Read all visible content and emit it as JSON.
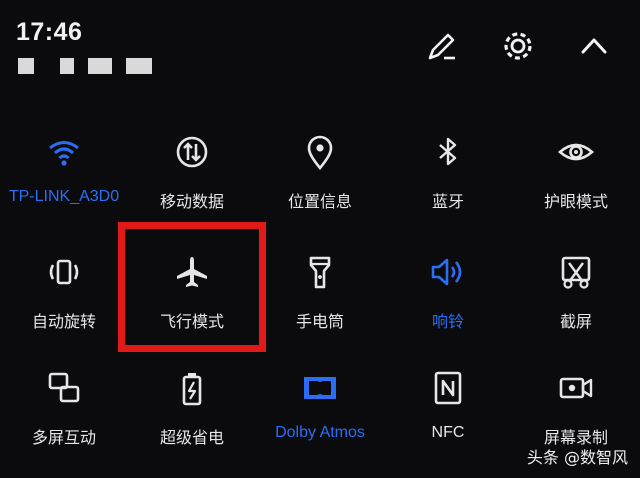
{
  "status": {
    "time": "17:46"
  },
  "header_icons": [
    {
      "name": "edit-icon"
    },
    {
      "name": "settings-icon"
    },
    {
      "name": "collapse-icon"
    }
  ],
  "tiles": [
    {
      "label": "TP-LINK_A3D0",
      "icon": "wifi-icon",
      "active": true
    },
    {
      "label": "移动数据",
      "icon": "mobile-data-icon",
      "active": false
    },
    {
      "label": "位置信息",
      "icon": "location-icon",
      "active": false
    },
    {
      "label": "蓝牙",
      "icon": "bluetooth-icon",
      "active": false
    },
    {
      "label": "护眼模式",
      "icon": "eye-icon",
      "active": false
    },
    {
      "label": "自动旋转",
      "icon": "auto-rotate-icon",
      "active": false
    },
    {
      "label": "飞行模式",
      "icon": "airplane-icon",
      "active": false
    },
    {
      "label": "手电筒",
      "icon": "flashlight-icon",
      "active": false
    },
    {
      "label": "响铃",
      "icon": "volume-icon",
      "active": true
    },
    {
      "label": "截屏",
      "icon": "screenshot-icon",
      "active": false
    },
    {
      "label": "多屏互动",
      "icon": "multi-screen-icon",
      "active": false
    },
    {
      "label": "超级省电",
      "icon": "battery-saver-icon",
      "active": false
    },
    {
      "label": "Dolby Atmos",
      "icon": "dolby-icon",
      "active": true
    },
    {
      "label": "NFC",
      "icon": "nfc-icon",
      "active": false
    },
    {
      "label": "屏幕录制",
      "icon": "screen-record-icon",
      "active": false
    }
  ],
  "colors": {
    "active": "#2b6ef5",
    "inactive": "#e6e6e6",
    "highlight": "#e21919"
  },
  "watermark": "头条 @数智风"
}
